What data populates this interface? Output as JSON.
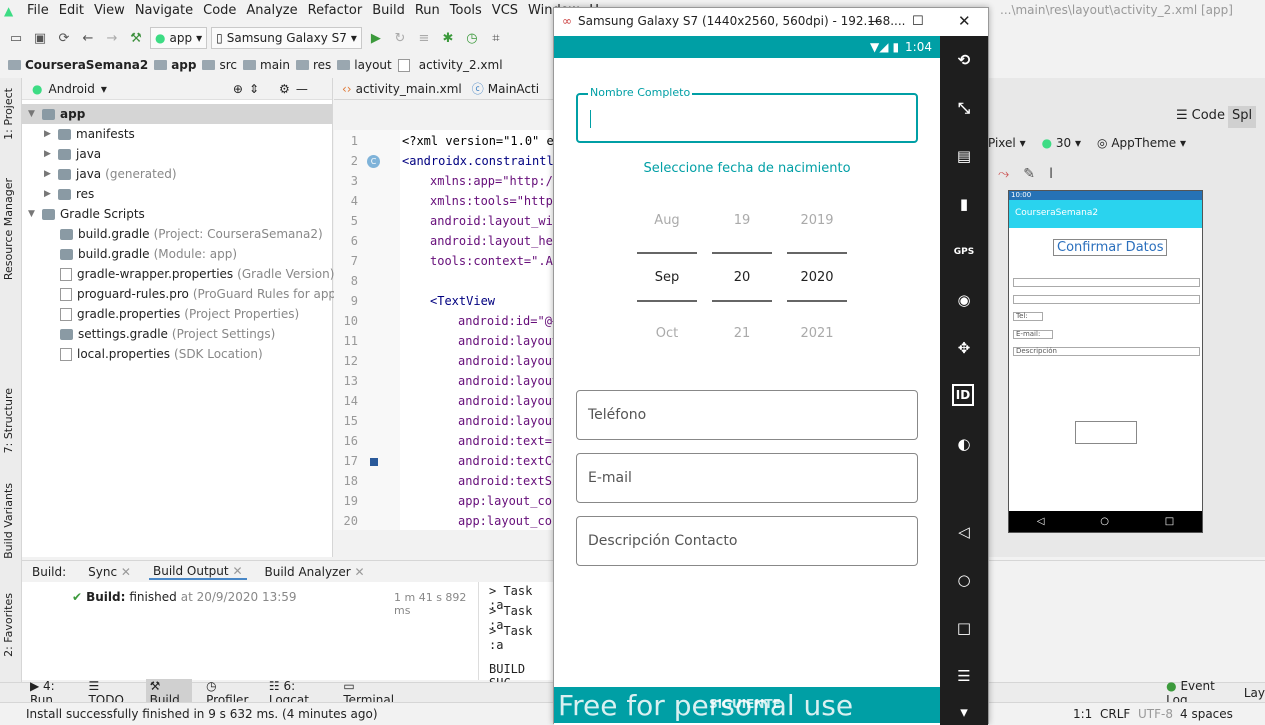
{
  "menubar": {
    "items": [
      "File",
      "Edit",
      "View",
      "Navigate",
      "Code",
      "Analyze",
      "Refactor",
      "Build",
      "Run",
      "Tools",
      "VCS",
      "Window",
      "H"
    ],
    "title_right": "...\\main\\res\\layout\\activity_2.xml [app]"
  },
  "toolbar": {
    "config": "app",
    "device": "Samsung Galaxy S7"
  },
  "breadcrumb": [
    "CourseraSemana2",
    "app",
    "src",
    "main",
    "res",
    "layout",
    "activity_2.xml"
  ],
  "project_panel": {
    "view_mode": "Android",
    "tree": [
      {
        "label": "app",
        "grey": ""
      },
      {
        "label": "manifests",
        "grey": ""
      },
      {
        "label": "java",
        "grey": ""
      },
      {
        "label": "java",
        "grey": "(generated)"
      },
      {
        "label": "res",
        "grey": ""
      },
      {
        "label": "Gradle Scripts",
        "grey": ""
      },
      {
        "label": "build.gradle",
        "grey": "(Project: CourseraSemana2)"
      },
      {
        "label": "build.gradle",
        "grey": "(Module: app)"
      },
      {
        "label": "gradle-wrapper.properties",
        "grey": "(Gradle Version)"
      },
      {
        "label": "proguard-rules.pro",
        "grey": "(ProGuard Rules for app)"
      },
      {
        "label": "gradle.properties",
        "grey": "(Project Properties)"
      },
      {
        "label": "settings.gradle",
        "grey": "(Project Settings)"
      },
      {
        "label": "local.properties",
        "grey": "(SDK Location)"
      }
    ]
  },
  "left_strip": [
    "1: Project",
    "Resource Manager",
    "7: Structure",
    "Build Variants",
    "2: Favorites"
  ],
  "editor": {
    "tabs": [
      "activity_main.xml",
      "MainActi"
    ],
    "lines": [
      {
        "n": "1",
        "text": "<?xml version=\"1.0\" en"
      },
      {
        "n": "2",
        "text": "<androidx.constraintla"
      },
      {
        "n": "3",
        "text": "xmlns:app=\"http://"
      },
      {
        "n": "4",
        "text": "xmlns:tools=\"http:"
      },
      {
        "n": "5",
        "text": "android:layout_wid"
      },
      {
        "n": "6",
        "text": "android:layout_hei"
      },
      {
        "n": "7",
        "text": "tools:context=\".Ac"
      },
      {
        "n": "8",
        "text": ""
      },
      {
        "n": "9",
        "text": "<TextView"
      },
      {
        "n": "10",
        "text": "android:id=\"@+"
      },
      {
        "n": "11",
        "text": "android:layout"
      },
      {
        "n": "12",
        "text": "android:layout"
      },
      {
        "n": "13",
        "text": "android:layout"
      },
      {
        "n": "14",
        "text": "android:layout"
      },
      {
        "n": "15",
        "text": "android:layout"
      },
      {
        "n": "16",
        "text": "android:text=\""
      },
      {
        "n": "17",
        "text": "android:textCo"
      },
      {
        "n": "18",
        "text": "android:textSi"
      },
      {
        "n": "19",
        "text": "app:layout_con"
      },
      {
        "n": "20",
        "text": "app:layout_con"
      }
    ]
  },
  "design": {
    "code_label": "Code",
    "split_label": "Spl",
    "pixel_label": "Pixel",
    "api": "30",
    "theme": "AppTheme",
    "preview_time": "10:00",
    "preview_app": "CourseraSemana2",
    "preview_title": "Confirmar Datos",
    "preview_tel": "Tel:",
    "preview_email": "E-mail:",
    "preview_desc": "Descripción"
  },
  "bottom": {
    "tabs": [
      "Build:",
      "Sync",
      "Build Output",
      "Build Analyzer"
    ],
    "build_status_bold": "Build:",
    "build_status": "finished",
    "build_time_label": "at 20/9/2020 13:59",
    "build_duration": "1 m 41 s 892 ms",
    "log": [
      "> Task :a",
      "> Task :a",
      "> Task :a",
      "",
      "BUILD SUC"
    ]
  },
  "bottom_tool_tabs": [
    "4: Run",
    "TODO",
    "Build",
    "Profiler",
    "6: Logcat",
    "Terminal"
  ],
  "event_log": "Event Log",
  "layout_inspector": "Lay",
  "status": {
    "message": "Install successfully finished in 9 s 632 ms. (4 minutes ago)",
    "pos": "1:1",
    "lf": "CRLF",
    "encoding": "UTF-8",
    "indent": "4 spaces"
  },
  "emulator": {
    "title": "Samsung Galaxy S7 (1440x2560, 560dpi) - 192.168....",
    "time": "1:04",
    "name_label": "Nombre Completo",
    "date_label": "Seleccione fecha de nacimiento",
    "picker": {
      "months": [
        "Aug",
        "Sep",
        "Oct"
      ],
      "days": [
        "19",
        "20",
        "21"
      ],
      "years": [
        "2019",
        "2020",
        "2021"
      ]
    },
    "phone_placeholder": "Teléfono",
    "email_placeholder": "E-mail",
    "desc_placeholder": "Descripción Contacto",
    "siguiente": "SIGUIENTE",
    "watermark": "Free for personal use",
    "accent_color": "#009fa5"
  }
}
